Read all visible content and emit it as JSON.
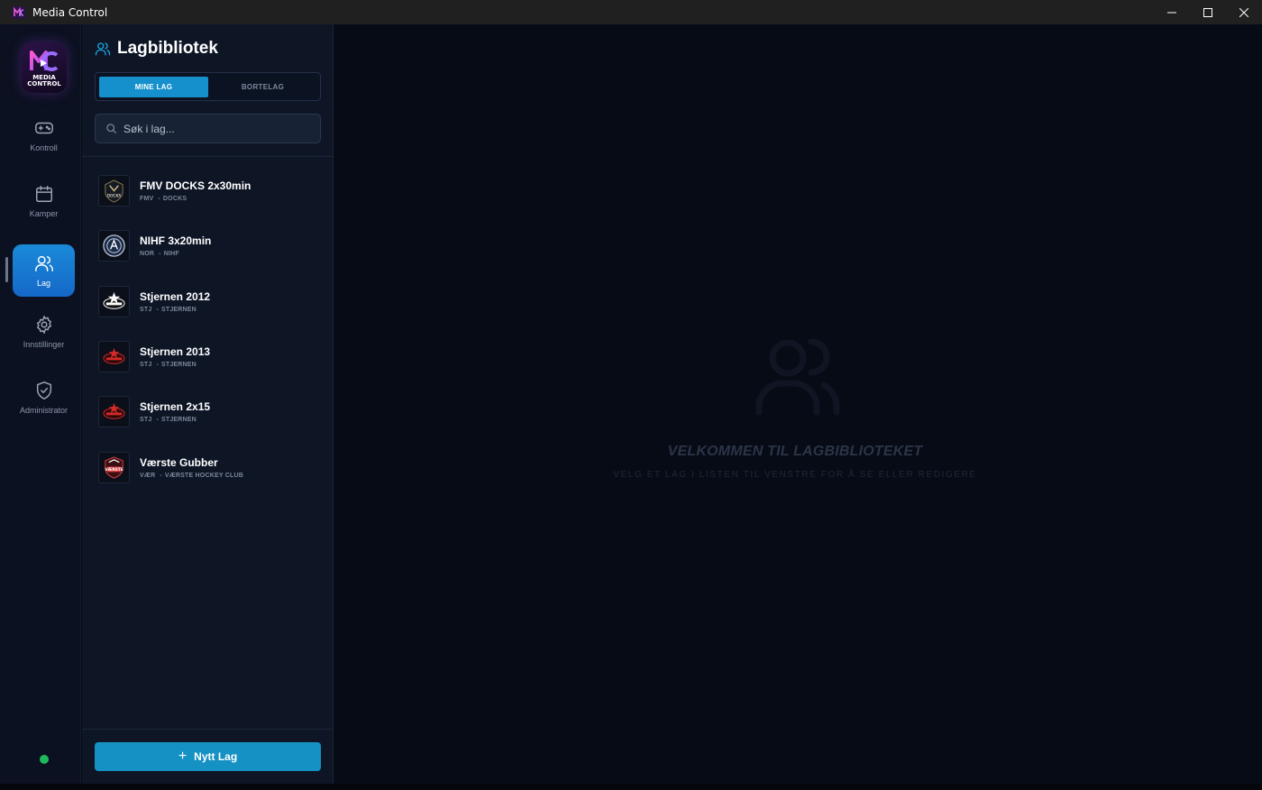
{
  "window": {
    "title": "Media Control"
  },
  "nav": {
    "logo_text_line1": "MEDIA",
    "logo_text_line2": "CONTROL",
    "items": [
      {
        "label": "Kontroll",
        "icon": "gamepad-icon"
      },
      {
        "label": "Kamper",
        "icon": "calendar-icon"
      },
      {
        "label": "Lag",
        "icon": "users-icon",
        "active": true
      },
      {
        "label": "Innstillinger",
        "icon": "gear-icon"
      },
      {
        "label": "Administrator",
        "icon": "shield-check-icon"
      }
    ],
    "status_color": "#1fb85a"
  },
  "library": {
    "title": "Lagbibliotek",
    "tabs": [
      {
        "label": "MINE LAG",
        "active": true
      },
      {
        "label": "BORTELAG",
        "active": false
      }
    ],
    "search": {
      "placeholder": "Søk i lag...",
      "value": ""
    },
    "teams": [
      {
        "name": "FMV DOCKS 2x30min",
        "code": "FMV",
        "club": "DOCKS"
      },
      {
        "name": "NIHF 3x20min",
        "code": "NOR",
        "club": "NIHF"
      },
      {
        "name": "Stjernen 2012",
        "code": "STJ",
        "club": "STJERNEN"
      },
      {
        "name": "Stjernen 2013",
        "code": "STJ",
        "club": "STJERNEN"
      },
      {
        "name": "Stjernen 2x15",
        "code": "STJ",
        "club": "STJERNEN"
      },
      {
        "name": "Værste Gubber",
        "code": "VÆR",
        "club": "VÆRSTE HOCKEY CLUB"
      }
    ],
    "new_button": "Nytt Lag"
  },
  "main": {
    "welcome_title": "VELKOMMEN TIL LAGBIBLIOTEKET",
    "welcome_subtitle": "VELG ET LAG I LISTEN TIL VENSTRE FOR Å SE ELLER REDIGERE"
  },
  "colors": {
    "accent": "#1590cc",
    "nav_active": "#1a7fd4",
    "background": "#070b15"
  }
}
